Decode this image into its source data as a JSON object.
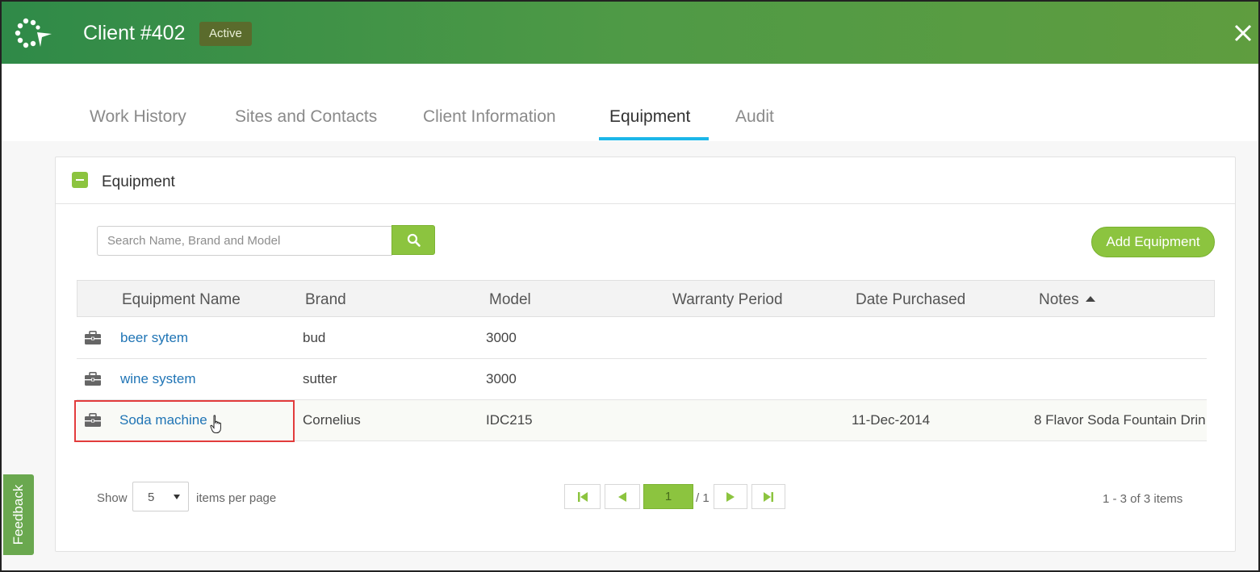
{
  "header": {
    "title": "Client #402",
    "status": "Active",
    "close_icon": "close-icon",
    "logo_icon": "dots-arrow-logo",
    "color": "#4a9447"
  },
  "tabs": [
    {
      "label": "Work History",
      "active": false
    },
    {
      "label": "Sites and Contacts",
      "active": false
    },
    {
      "label": "Client Information",
      "active": false
    },
    {
      "label": "Equipment",
      "active": true
    },
    {
      "label": "Audit",
      "active": false
    }
  ],
  "panel": {
    "title": "Equipment",
    "search": {
      "placeholder": "Search Name, Brand and Model",
      "value": ""
    },
    "add_button": "Add Equipment",
    "accent_color": "#8cc43f",
    "link_color": "#1f74b5",
    "tab_active_color": "#1bb6e8"
  },
  "table": {
    "columns": [
      "Equipment Name",
      "Brand",
      "Model",
      "Warranty Period",
      "Date Purchased",
      "Notes"
    ],
    "sort_column": "Notes",
    "sort_direction": "ascending",
    "rows": [
      {
        "name": "beer sytem",
        "brand": "bud",
        "model": "3000",
        "warranty": "",
        "date": "",
        "notes": ""
      },
      {
        "name": "wine system",
        "brand": "sutter",
        "model": "3000",
        "warranty": "",
        "date": "",
        "notes": ""
      },
      {
        "name": "Soda machine",
        "brand": "Cornelius",
        "model": "IDC215",
        "warranty": "",
        "date": "11-Dec-2014",
        "notes": "8 Flavor Soda Fountain Drin"
      }
    ],
    "highlighted_row": 2
  },
  "pager": {
    "show_label": "Show",
    "page_size": "5",
    "per_page_label": "items per page",
    "current_page": "1",
    "total_pages_label": "/ 1",
    "summary": "1 - 3 of 3 items"
  },
  "feedback": {
    "label": "Feedback"
  }
}
